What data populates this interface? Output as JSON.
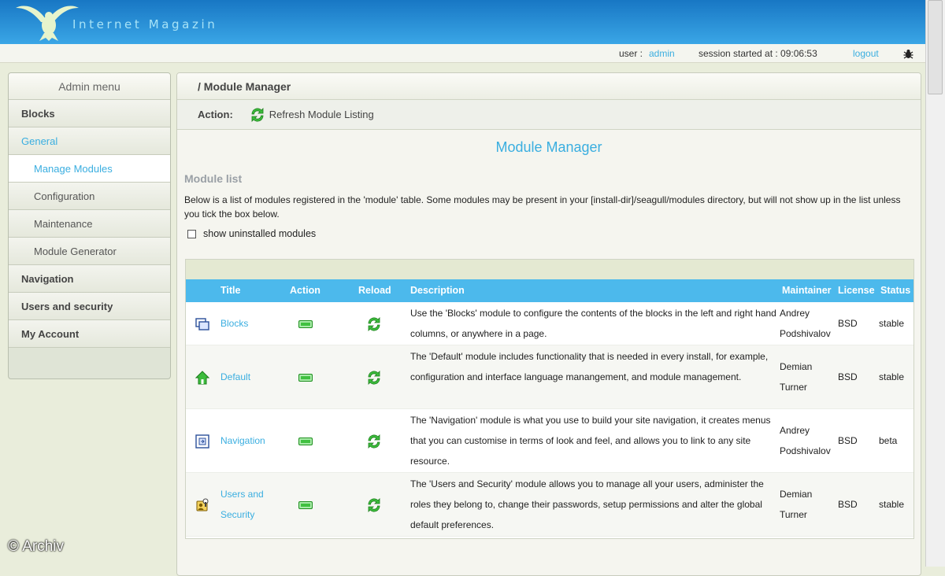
{
  "header": {
    "site_name": "Internet Magazin"
  },
  "userbar": {
    "user_label": "user :",
    "user_name": "admin",
    "session_text": "session started at : 09:06:53",
    "logout_label": "logout"
  },
  "sidebar": {
    "title": "Admin menu",
    "items": [
      {
        "label": "Blocks"
      },
      {
        "label": "General"
      },
      {
        "label": "Manage Modules"
      },
      {
        "label": "Configuration"
      },
      {
        "label": "Maintenance"
      },
      {
        "label": "Module Generator"
      },
      {
        "label": "Navigation"
      },
      {
        "label": "Users and security"
      },
      {
        "label": "My Account"
      }
    ]
  },
  "main": {
    "breadcrumb": "/ Module Manager",
    "action_label": "Action:",
    "refresh_label": "Refresh Module Listing",
    "title": "Module Manager",
    "section_title": "Module list",
    "intro": "Below is a list of modules registered in the 'module' table. Some modules may be present in your [install-dir]/seagull/modules directory, but will not show up in the list unless you tick the box below.",
    "show_uninstalled_label": "show uninstalled modules",
    "table": {
      "headers": {
        "title": "Title",
        "action": "Action",
        "reload": "Reload",
        "description": "Description",
        "maintainer": "Maintainer",
        "license": "License",
        "status": "Status"
      },
      "rows": [
        {
          "icon": "blocks-icon",
          "title": "Blocks",
          "description": "Use the 'Blocks' module to configure the contents of the blocks in the left and right hand columns, or anywhere in a page.",
          "maintainer": "Andrey Podshivalov",
          "license": "BSD",
          "status": "stable"
        },
        {
          "icon": "home-icon",
          "title": "Default",
          "description": "The 'Default' module includes functionality that is needed in every install, for example, configuration and interface language manangement, and module management.",
          "maintainer": "Demian Turner",
          "license": "BSD",
          "status": "stable"
        },
        {
          "icon": "navigation-icon",
          "title": "Navigation",
          "description": "The 'Navigation' module is what you use to build your site navigation, it creates menus that you can customise in terms of look and feel, and allows you to link to any site resource.",
          "maintainer": "Andrey Podshivalov",
          "license": "BSD",
          "status": "beta"
        },
        {
          "icon": "users-icon",
          "title": "Users and Security",
          "description": "The 'Users and Security' module allows you to manage all your users, administer the roles they belong to, change their passwords, setup permissions and alter the global default preferences.",
          "maintainer": "Demian Turner",
          "license": "BSD",
          "status": "stable"
        }
      ]
    }
  },
  "watermark": "© Archiv",
  "colors": {
    "header_top": "#1877c4",
    "header_bottom": "#3aa6e6",
    "link": "#3aaee0",
    "table_header": "#4cb9ec",
    "status_green": "#40c040"
  }
}
